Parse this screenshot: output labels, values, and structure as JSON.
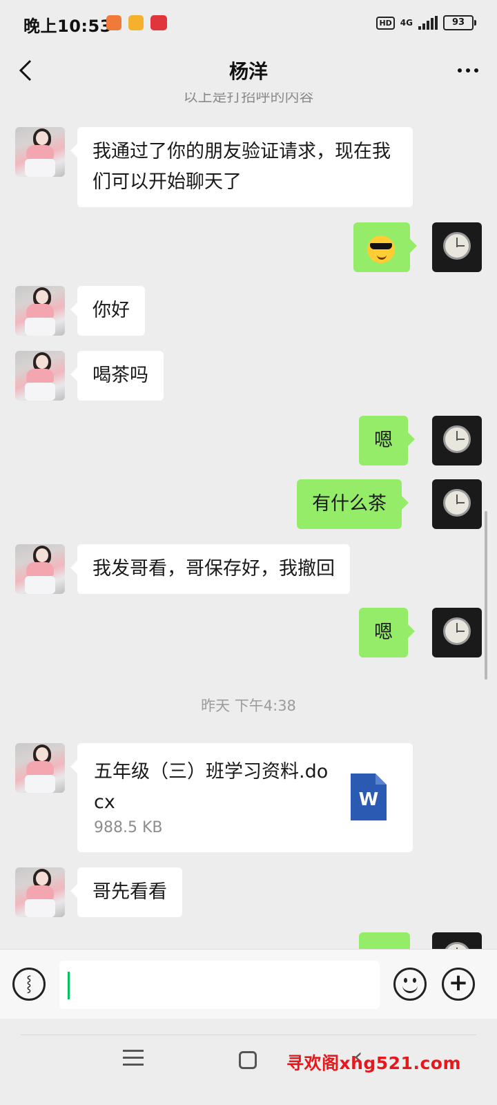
{
  "status_bar": {
    "time": "晚上10:53",
    "network_hd": "HD",
    "network_type": "4G",
    "battery": "93"
  },
  "header": {
    "title": "杨洋",
    "back_icon": "chevron-left-icon",
    "more_icon": "more-dots-icon"
  },
  "chat": {
    "cut_notice": "以上是打招呼的内容",
    "messages": [
      {
        "side": "left",
        "text": "我通过了你的朋友验证请求，现在我们可以开始聊天了"
      },
      {
        "side": "right",
        "type": "emoji",
        "emoji": "sunglasses-smile-emoji"
      },
      {
        "side": "left",
        "text": "你好"
      },
      {
        "side": "left",
        "text": "喝茶吗"
      },
      {
        "side": "right",
        "text": "嗯"
      },
      {
        "side": "right",
        "text": "有什么茶"
      },
      {
        "side": "left",
        "text": "我发哥看，哥保存好，我撤回"
      },
      {
        "side": "right",
        "text": "嗯"
      },
      {
        "type": "time",
        "text": "昨天 下午4:38"
      },
      {
        "side": "left",
        "type": "file",
        "file_name": "五年级（三）班学习资料.docx",
        "file_size": "988.5 KB",
        "file_icon_letter": "W"
      },
      {
        "side": "left",
        "text": "哥先看看"
      }
    ]
  },
  "input_bar": {
    "voice_icon": "voice-icon",
    "input_value": "",
    "emoji_icon": "emoji-icon",
    "plus_icon": "plus-icon"
  },
  "nav_bar": {
    "watermark": "寻欢阁xhg521.com"
  }
}
